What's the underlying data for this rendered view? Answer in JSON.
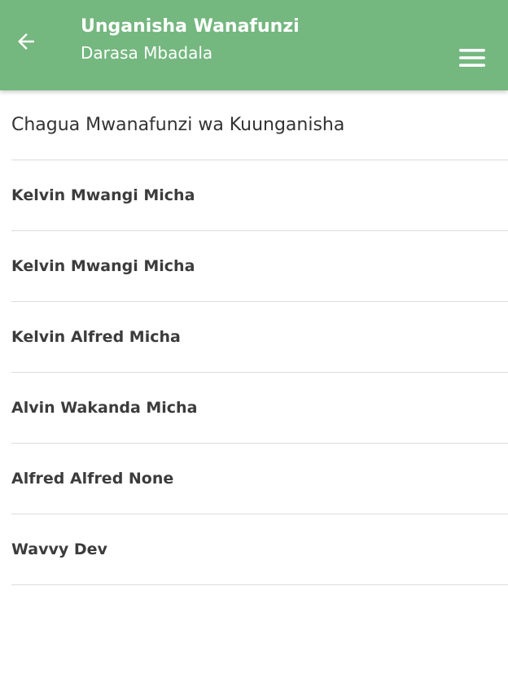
{
  "appbar": {
    "title": "Unganisha Wanafunzi",
    "subtitle": "Darasa Mbadala",
    "back_icon": "arrow-left-icon",
    "menu_icon": "hamburger-menu-icon",
    "background_color": "#74b77f"
  },
  "section": {
    "heading": "Chagua Mwanafunzi wa Kuunganisha"
  },
  "students": [
    {
      "name": "Kelvin Mwangi Micha"
    },
    {
      "name": "Kelvin Mwangi Micha"
    },
    {
      "name": "Kelvin Alfred Micha"
    },
    {
      "name": "Alvin Wakanda Micha"
    },
    {
      "name": "Alfred Alfred None"
    },
    {
      "name": "Wavvy Dev"
    }
  ]
}
